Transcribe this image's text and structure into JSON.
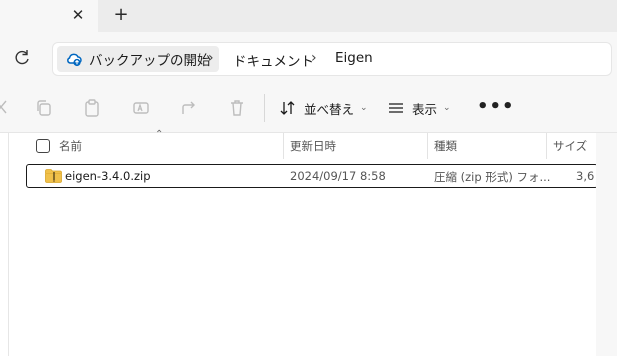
{
  "tabstrip": {
    "close_glyph": "✕",
    "new_tab_glyph": "+"
  },
  "breadcrumb": {
    "root": "バックアップの開始",
    "separator": "›",
    "items": [
      "ドキュメント",
      "Eigen"
    ]
  },
  "toolbar": {
    "icons": [
      "cut-icon",
      "copy-icon",
      "paste-icon",
      "rename-icon",
      "share-icon",
      "delete-icon"
    ],
    "sort_label": "並べ替え",
    "view_label": "表示",
    "more_label": "•••"
  },
  "columns": {
    "name": "名前",
    "modified": "更新日時",
    "type": "種類",
    "size": "サイズ"
  },
  "files": [
    {
      "name": "eigen-3.4.0.zip",
      "modified": "2024/09/17 8:58",
      "type": "圧縮 (zip 形式) フォ...",
      "size": "3,6"
    }
  ],
  "colors": {
    "accent_blue": "#0067c0",
    "folder_yellow": "#f0c04a"
  }
}
